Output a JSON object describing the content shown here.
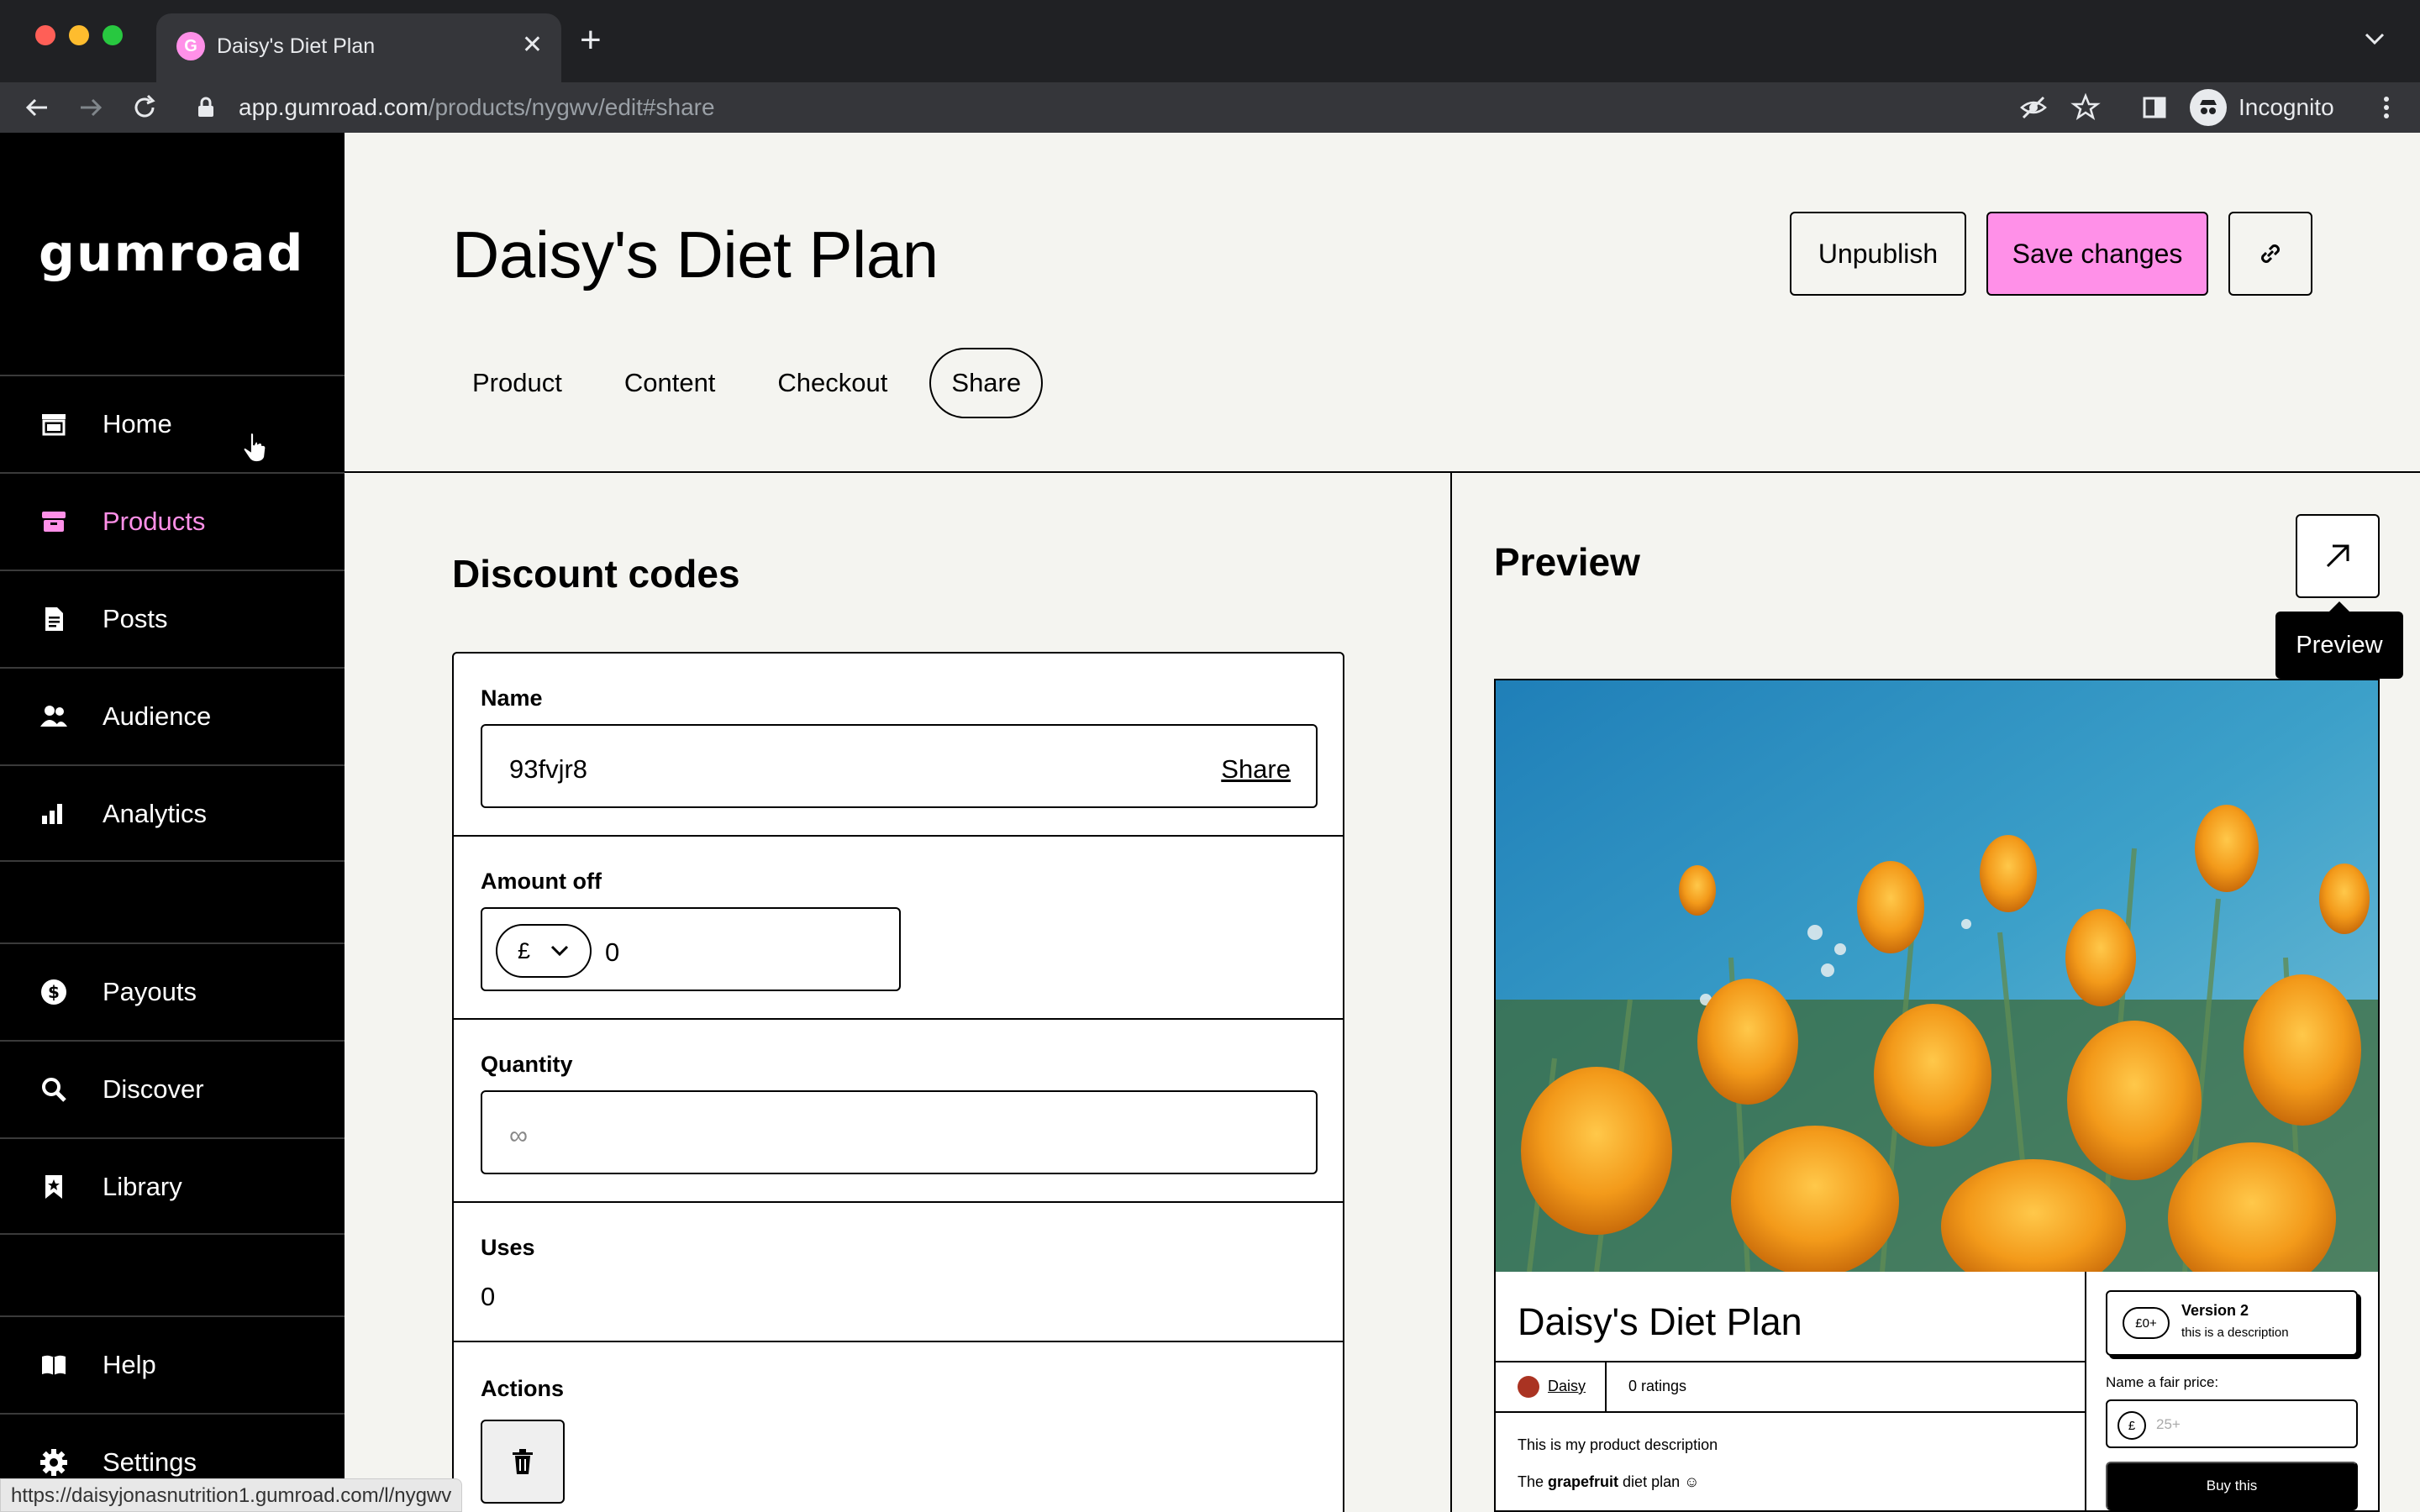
{
  "browser": {
    "tab_title": "Daisy's Diet Plan",
    "tab_favicon_letter": "G",
    "url_host": "app.gumroad.com",
    "url_path": "/products/nygwv/edit#share",
    "profile_label": "Incognito",
    "status_url": "https://daisyjonasnutrition1.gumroad.com/l/nygwv"
  },
  "sidebar": {
    "logo": "GUMROAD",
    "items": [
      {
        "label": "Home",
        "icon": "shop-icon"
      },
      {
        "label": "Products",
        "icon": "archive-icon"
      },
      {
        "label": "Posts",
        "icon": "document-icon"
      },
      {
        "label": "Audience",
        "icon": "people-icon"
      },
      {
        "label": "Analytics",
        "icon": "bar-chart-icon"
      },
      {
        "label": "Payouts",
        "icon": "dollar-circle-icon"
      },
      {
        "label": "Discover",
        "icon": "search-icon"
      },
      {
        "label": "Library",
        "icon": "bookmark-icon"
      },
      {
        "label": "Help",
        "icon": "book-icon"
      },
      {
        "label": "Settings",
        "icon": "gear-icon"
      }
    ],
    "active_item": "Products"
  },
  "header": {
    "title": "Daisy's Diet Plan",
    "unpublish_label": "Unpublish",
    "save_label": "Save changes",
    "tabs": [
      "Product",
      "Content",
      "Checkout",
      "Share"
    ],
    "active_tab": "Share"
  },
  "discount": {
    "section_title": "Discount codes",
    "name_label": "Name",
    "name_value": "93fvjr8",
    "share_label": "Share",
    "amount_label": "Amount off",
    "currency": "£",
    "amount_value": "0",
    "quantity_label": "Quantity",
    "quantity_placeholder": "∞",
    "uses_label": "Uses",
    "uses_value": "0",
    "actions_label": "Actions"
  },
  "preview": {
    "title": "Preview",
    "tooltip": "Preview",
    "product_title": "Daisy's Diet Plan",
    "author": "Daisy",
    "ratings": "0 ratings",
    "description_1": "This is my product description",
    "description_2_pre": "The ",
    "description_2_bold": "grapefruit",
    "description_2_post": " diet plan ☺",
    "version_price": "£0+",
    "version_name": "Version 2",
    "version_desc": "this is a description",
    "fair_price_label": "Name a fair price:",
    "price_currency": "£",
    "price_placeholder": "25+",
    "buy_label": "Buy this"
  },
  "colors": {
    "accent_pink": "#ff90e8",
    "background": "#f4f4f0",
    "sidebar": "#000000"
  }
}
